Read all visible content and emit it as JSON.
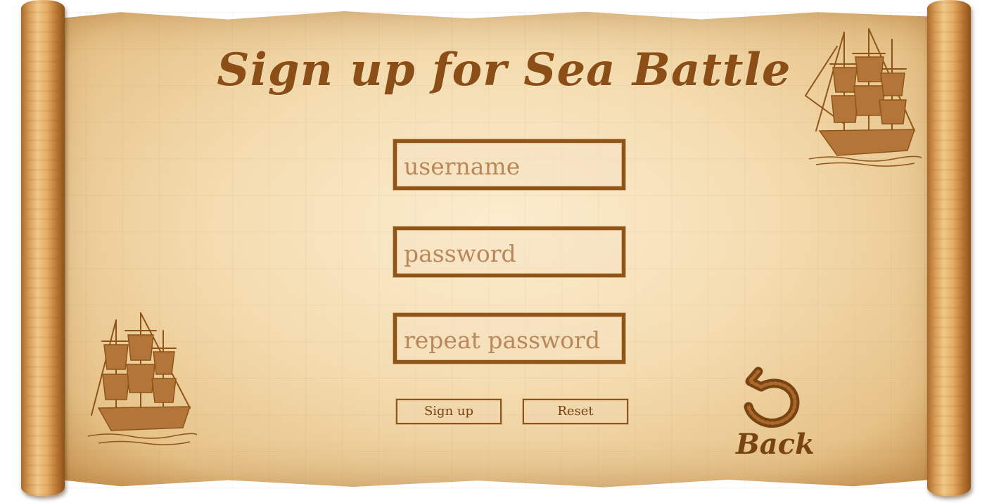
{
  "title": "Sign up for Sea Battle",
  "form": {
    "username_placeholder": "username",
    "password_placeholder": "password",
    "repeat_password_placeholder": "repeat password"
  },
  "buttons": {
    "signup_label": "Sign up",
    "reset_label": "Reset",
    "back_label": "Back"
  },
  "colors": {
    "ink": "#8a4e16",
    "parchment": "#f2d9a8",
    "border": "#8f5418"
  },
  "icons": {
    "back": "back-arrow-icon",
    "ship_top_right": "sailing-ship-icon",
    "ship_bottom_left": "sailing-ship-icon"
  }
}
